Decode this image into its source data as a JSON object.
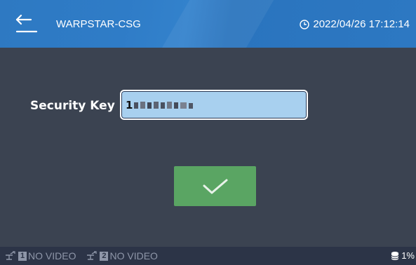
{
  "header": {
    "title": "WARPSTAR-CSG",
    "datetime": "2022/04/26 17:12:14",
    "back_icon": "back-arrow-icon",
    "clock_icon": "clock-icon"
  },
  "form": {
    "label": "Security Key",
    "value": "1"
  },
  "confirm": {
    "icon": "checkmark-icon"
  },
  "footer": {
    "channels": [
      {
        "number": "1",
        "status": "NO VIDEO"
      },
      {
        "number": "2",
        "status": "NO VIDEO"
      }
    ],
    "storage_percent": "1%"
  },
  "colors": {
    "background": "#3b4351",
    "header": "#2e79c2",
    "input": "#a8d0ef",
    "confirm": "#5aa563",
    "footer": "#2c3447"
  }
}
